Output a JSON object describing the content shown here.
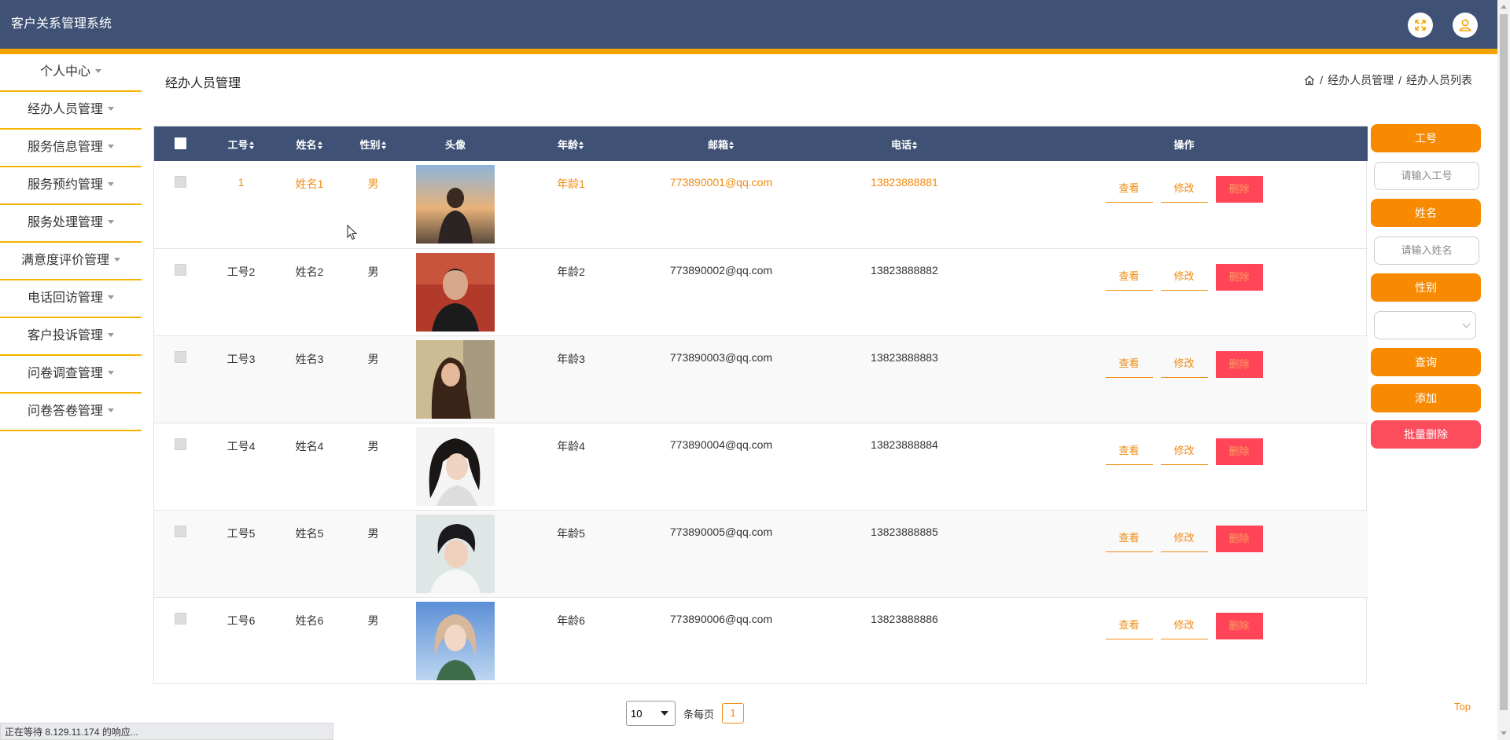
{
  "app": {
    "title": "客户关系管理系统"
  },
  "header": {
    "fullscreen_icon": "fullscreen-icon",
    "user_icon": "user-icon"
  },
  "sidebar": {
    "items": [
      {
        "label": "个人中心"
      },
      {
        "label": "经办人员管理"
      },
      {
        "label": "服务信息管理"
      },
      {
        "label": "服务预约管理"
      },
      {
        "label": "服务处理管理"
      },
      {
        "label": "满意度评价管理"
      },
      {
        "label": "电话回访管理"
      },
      {
        "label": "客户投诉管理"
      },
      {
        "label": "问卷调查管理"
      },
      {
        "label": "问卷答卷管理"
      }
    ]
  },
  "main": {
    "title": "经办人员管理",
    "breadcrumb": [
      "经办人员管理",
      "经办人员列表"
    ],
    "breadcrumb_sep": "/"
  },
  "table": {
    "columns": [
      "工号",
      "姓名",
      "性别",
      "头像",
      "年龄",
      "邮箱",
      "电话",
      "操作"
    ],
    "rows": [
      {
        "id": "1",
        "name": "姓名1",
        "gender": "男",
        "age": "年龄1",
        "email": "773890001@qq.com",
        "phone": "13823888881",
        "highlight": true
      },
      {
        "id": "工号2",
        "name": "姓名2",
        "gender": "男",
        "age": "年龄2",
        "email": "773890002@qq.com",
        "phone": "13823888882"
      },
      {
        "id": "工号3",
        "name": "姓名3",
        "gender": "男",
        "age": "年龄3",
        "email": "773890003@qq.com",
        "phone": "13823888883"
      },
      {
        "id": "工号4",
        "name": "姓名4",
        "gender": "男",
        "age": "年龄4",
        "email": "773890004@qq.com",
        "phone": "13823888884"
      },
      {
        "id": "工号5",
        "name": "姓名5",
        "gender": "男",
        "age": "年龄5",
        "email": "773890005@qq.com",
        "phone": "13823888885"
      },
      {
        "id": "工号6",
        "name": "姓名6",
        "gender": "男",
        "age": "年龄6",
        "email": "773890006@qq.com",
        "phone": "13823888886"
      }
    ],
    "actions": {
      "view": "查看",
      "edit": "修改",
      "delete": "删除"
    }
  },
  "search": {
    "id_label": "工号",
    "id_placeholder": "请输入工号",
    "name_label": "姓名",
    "name_placeholder": "请输入姓名",
    "gender_label": "性别",
    "gender_value": "",
    "query_button": "查询",
    "add_button": "添加",
    "batch_delete_button": "批量删除"
  },
  "pager": {
    "page_size": "10",
    "per_page_label": "条每页",
    "current_page": "1"
  },
  "top_link": "Top",
  "status_bar": "正在等待 8.129.11.174 的响应...",
  "colors": {
    "header": "#3f5275",
    "accent": "#f4a400",
    "orange": "#f78a00",
    "red": "#ff4557"
  }
}
